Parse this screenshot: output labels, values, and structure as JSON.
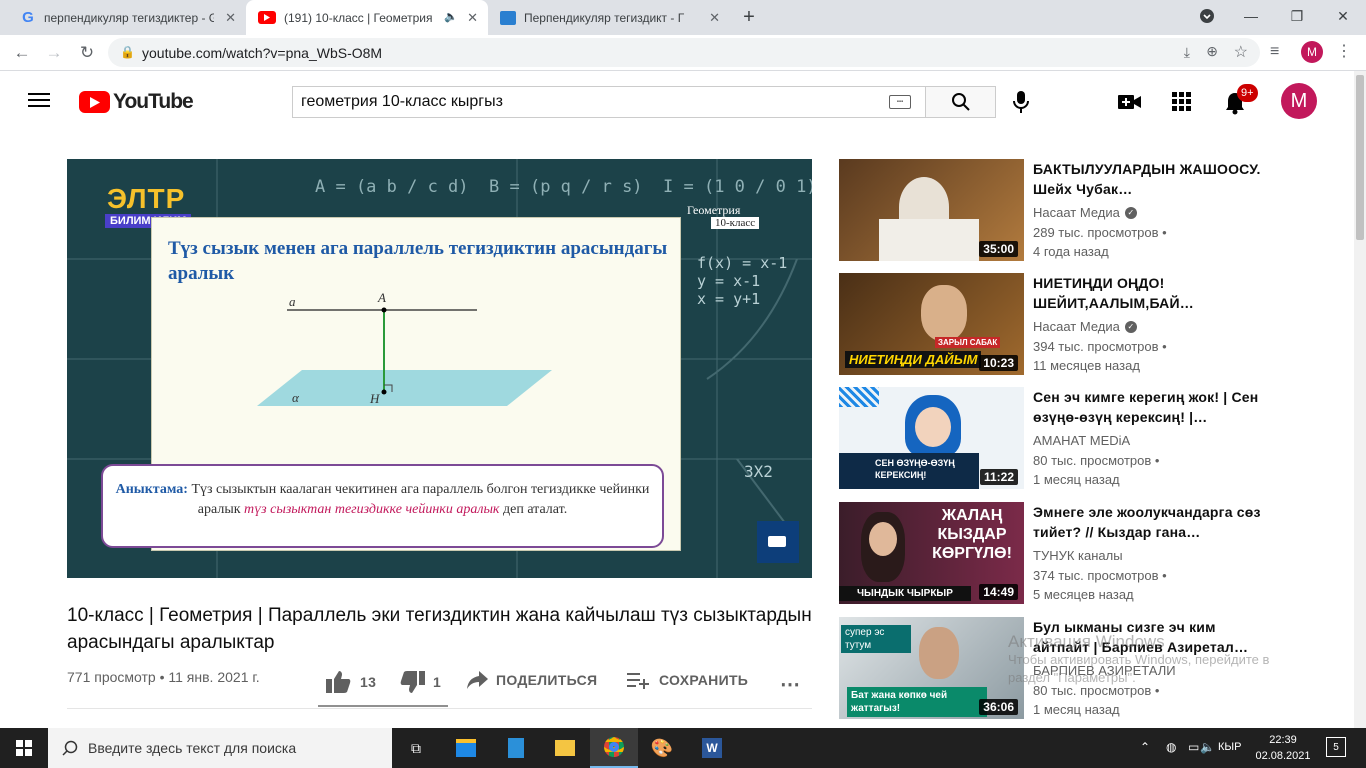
{
  "browser": {
    "tabs": [
      {
        "title": "перпендикуляр тегиздиктер - G",
        "icon": "google-icon"
      },
      {
        "title": "(191) 10-класс | Геометрия |",
        "icon": "youtube-icon",
        "active": true
      },
      {
        "title": "Перпендикуляр тегиздикт - Г",
        "icon": "book-icon"
      }
    ],
    "url": "youtube.com/watch?v=pna_WbS-O8M",
    "profile_letter": "M"
  },
  "youtube": {
    "logo_text": "YouTube",
    "search_value": "геометрия 10-класс кыргыз",
    "notifications_badge": "9+",
    "avatar_letter": "M"
  },
  "video": {
    "channel_logo_text": "ЭЛТР",
    "channel_logo_sub": "БИЛИМ ИЛИМ",
    "corner_tag_1": "Геометрия",
    "corner_tag_2": "10-класс",
    "slide_title": "Түз сызык менен ага параллель тегиздиктин арасындагы аралык",
    "diagram": {
      "line_label": "a",
      "top_point": "A",
      "plane_label": "α",
      "bottom_point": "H"
    },
    "definition_head": "Аныктама:",
    "definition_text_1": " Түз сызыктын каалаган чекитинен ага параллель болгон тегиздикке чейинки аралык ",
    "definition_em": "түз сызыктан тегиздикке чейинки аралык",
    "definition_text_2": " деп аталат.",
    "board_formulas": [
      "A = (a b / c d)",
      "B = (p q / r s)",
      "I = (1 0 / 0 1)",
      "f(x) = x-1",
      "y = x-1",
      "x = y+1",
      "3X2"
    ],
    "title": "10-класс | Геометрия | Параллель эки тегиздиктин жана кайчылаш түз сызыктардын арасындагы аралыктар",
    "meta": "771 просмотр • 11 янв. 2021 г.",
    "likes": "13",
    "dislikes": "1",
    "share_label": "ПОДЕЛИТЬСЯ",
    "save_label": "СОХРАНИТЬ"
  },
  "recommendations": [
    {
      "title": "БАКТЫЛУУЛАРДЫН ЖАШООСУ. Шейх Чубак…",
      "channel": "Насаат Медиа",
      "verified": true,
      "views": "289 тыс. просмотров •",
      "age": "4 года назад",
      "duration": "35:00"
    },
    {
      "title": "НИЕТИҢДИ ОҢДО! ШЕЙИТ,ААЛЫМ,БАЙ…",
      "channel": "Насаат Медиа",
      "verified": true,
      "views": "394 тыс. просмотров •",
      "age": "11 месяцев назад",
      "duration": "10:23",
      "thumb_text": "НИЕТИҢДИ ДАЙЫМ",
      "thumb_tag": "ЗАРЫЛ САБАК"
    },
    {
      "title": "Сен эч кимге керегиң жок! | Сен өзүңө-өзүң керексиң! |…",
      "channel": "АМАНАТ МЕDiA",
      "verified": false,
      "views": "80 тыс. просмотров •",
      "age": "1 месяц назад",
      "duration": "11:22",
      "thumb_text": "СЕН ӨЗҮҢӨ-ӨЗҮҢ КЕРЕКСИҢ!"
    },
    {
      "title": "Эмнеге эле жоолукчандарга сөз тийет? // Кыздар гана…",
      "channel": "ТУНУК каналы",
      "verified": false,
      "views": "374 тыс. просмотров •",
      "age": "5 месяцев назад",
      "duration": "14:49",
      "thumb_text": "ЖАЛАҢ КЫЗДАР КӨРГҮЛӨ!",
      "thumb_tag": "ЧЫНДЫК ЧЫРКЫР"
    },
    {
      "title": "Бул ыкманы сизге эч ким айтпайт | Барпиев Азиретал…",
      "channel": "БАРПИЕВ АЗИРЕТАЛИ",
      "verified": false,
      "views": "80 тыс. просмотров •",
      "age": "1 месяц назад",
      "duration": "36:06",
      "thumb_text": "Бат жана көпкө чей жаттагыз!",
      "thumb_tag": "супер эс тутум"
    }
  ],
  "watermark": {
    "line1": "Активация Windows",
    "line2": "Чтобы активировать Windows, перейдите в",
    "line3": "раздел \"Параметры\"."
  },
  "taskbar": {
    "search_placeholder": "Введите здесь текст для поиска",
    "lang": "КЫР",
    "time": "22:39",
    "date": "02.08.2021",
    "notif_count": "5"
  }
}
